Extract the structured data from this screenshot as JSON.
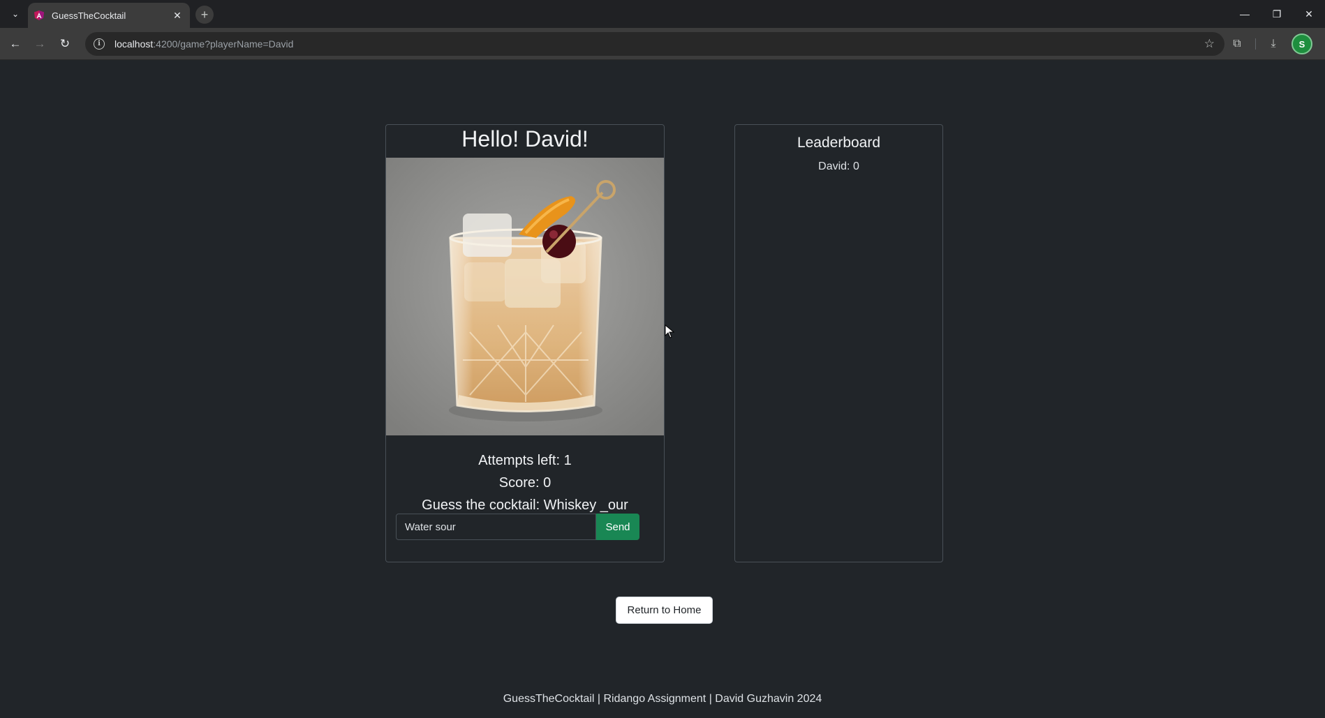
{
  "browser": {
    "tab_title": "GuessTheCocktail",
    "url_host": "localhost",
    "url_rest": ":4200/game?playerName=David",
    "profile_initial": "S"
  },
  "game": {
    "greeting": "Hello! David!",
    "attempts_left": "Attempts left: 1",
    "score": "Score: 0",
    "guess_prompt": "Guess the cocktail: Whiskey _our",
    "guess_input_value": "Water sour",
    "send_label": "Send",
    "image_subject": "whiskey-sour-cocktail"
  },
  "leaderboard": {
    "title": "Leaderboard",
    "entries": [
      "David: 0"
    ]
  },
  "actions": {
    "return_home_label": "Return to Home"
  },
  "footer": {
    "text": "GuessTheCocktail | Ridango Assignment | David Guzhavin 2024"
  },
  "colors": {
    "page_bg": "#212529",
    "send_button": "#198754",
    "card_border": "#495057"
  }
}
